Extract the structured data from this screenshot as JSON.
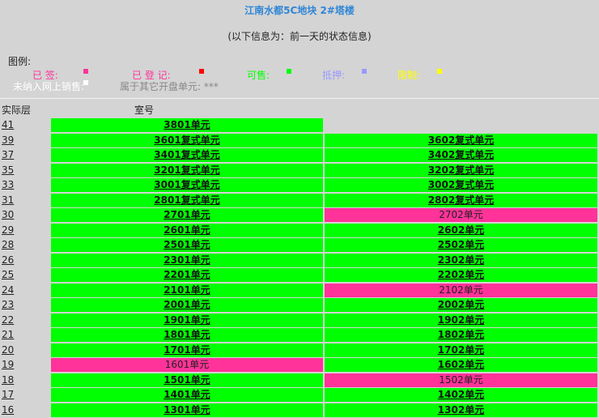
{
  "header": {
    "title": "江南水都5C地块  2#塔楼",
    "subtitle": "(以下信息为：前一天的状态信息)"
  },
  "legend": {
    "heading": "图例:",
    "signed": "已  签:",
    "registered": "已  登  记:",
    "for_sale": "可售:",
    "mortgaged": "抵押:",
    "restricted": "限制:",
    "not_online": "未纳入网上销售:",
    "other_units": "属于其它开盘单元: ***",
    "colors": {
      "signed": "#ff3399",
      "registered": "#ff0000",
      "for_sale": "#00ff00",
      "mortgaged": "#9999ff",
      "restricted": "#ffff00",
      "not_online": "#ffffff"
    }
  },
  "table": {
    "col_floor": "实际层",
    "col_room": "室号",
    "rows": [
      {
        "floor": "41",
        "units": [
          {
            "label": "3801单元",
            "status": "sale"
          }
        ]
      },
      {
        "floor": "39",
        "units": [
          {
            "label": "3601复式单元",
            "status": "sale"
          },
          {
            "label": "3602复式单元",
            "status": "sale"
          }
        ]
      },
      {
        "floor": "37",
        "units": [
          {
            "label": "3401复式单元",
            "status": "sale"
          },
          {
            "label": "3402复式单元",
            "status": "sale"
          }
        ]
      },
      {
        "floor": "35",
        "units": [
          {
            "label": "3201复式单元",
            "status": "sale"
          },
          {
            "label": "3202复式单元",
            "status": "sale"
          }
        ]
      },
      {
        "floor": "33",
        "units": [
          {
            "label": "3001复式单元",
            "status": "sale"
          },
          {
            "label": "3002复式单元",
            "status": "sale"
          }
        ]
      },
      {
        "floor": "31",
        "units": [
          {
            "label": "2801复式单元",
            "status": "sale"
          },
          {
            "label": "2802复式单元",
            "status": "sale"
          }
        ]
      },
      {
        "floor": "30",
        "units": [
          {
            "label": "2701单元",
            "status": "sale"
          },
          {
            "label": "2702单元",
            "status": "signed"
          }
        ]
      },
      {
        "floor": "29",
        "units": [
          {
            "label": "2601单元",
            "status": "sale"
          },
          {
            "label": "2602单元",
            "status": "sale"
          }
        ]
      },
      {
        "floor": "28",
        "units": [
          {
            "label": "2501单元",
            "status": "sale"
          },
          {
            "label": "2502单元",
            "status": "sale"
          }
        ]
      },
      {
        "floor": "26",
        "units": [
          {
            "label": "2301单元",
            "status": "sale"
          },
          {
            "label": "2302单元",
            "status": "sale"
          }
        ]
      },
      {
        "floor": "25",
        "units": [
          {
            "label": "2201单元",
            "status": "sale"
          },
          {
            "label": "2202单元",
            "status": "sale"
          }
        ]
      },
      {
        "floor": "24",
        "units": [
          {
            "label": "2101单元",
            "status": "sale"
          },
          {
            "label": "2102单元",
            "status": "signed"
          }
        ]
      },
      {
        "floor": "23",
        "units": [
          {
            "label": "2001单元",
            "status": "sale"
          },
          {
            "label": "2002单元",
            "status": "sale"
          }
        ]
      },
      {
        "floor": "22",
        "units": [
          {
            "label": "1901单元",
            "status": "sale"
          },
          {
            "label": "1902单元",
            "status": "sale"
          }
        ]
      },
      {
        "floor": "21",
        "units": [
          {
            "label": "1801单元",
            "status": "sale"
          },
          {
            "label": "1802单元",
            "status": "sale"
          }
        ]
      },
      {
        "floor": "20",
        "units": [
          {
            "label": "1701单元",
            "status": "sale"
          },
          {
            "label": "1702单元",
            "status": "sale"
          }
        ]
      },
      {
        "floor": "19",
        "units": [
          {
            "label": "1601单元",
            "status": "signed"
          },
          {
            "label": "1602单元",
            "status": "sale"
          }
        ]
      },
      {
        "floor": "18",
        "units": [
          {
            "label": "1501单元",
            "status": "sale"
          },
          {
            "label": "1502单元",
            "status": "signed"
          }
        ]
      },
      {
        "floor": "17",
        "units": [
          {
            "label": "1401单元",
            "status": "sale"
          },
          {
            "label": "1402单元",
            "status": "sale"
          }
        ]
      },
      {
        "floor": "16",
        "units": [
          {
            "label": "1301单元",
            "status": "sale"
          },
          {
            "label": "1302单元",
            "status": "sale"
          }
        ]
      }
    ]
  }
}
